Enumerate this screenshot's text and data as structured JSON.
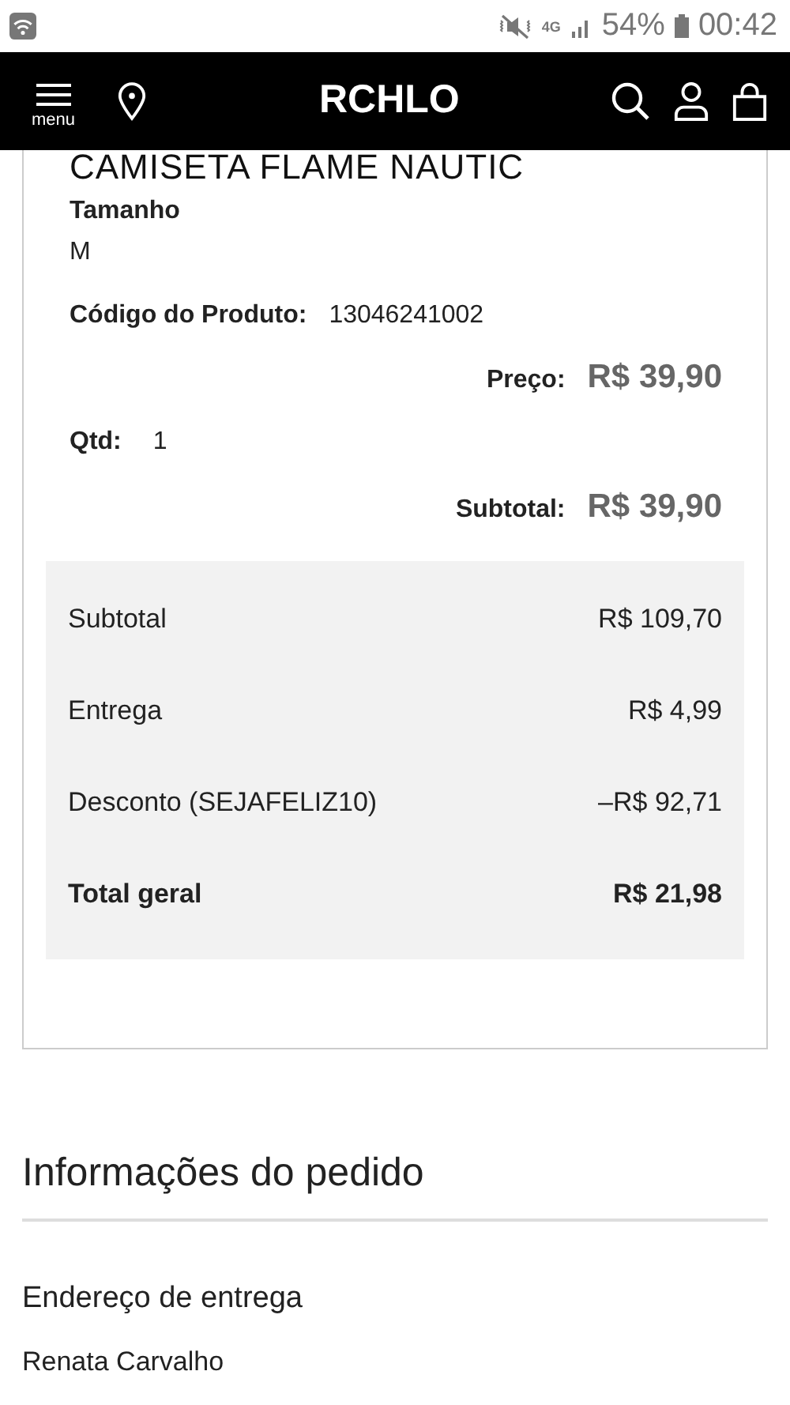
{
  "status_bar": {
    "network": "4G",
    "battery": "54%",
    "time": "00:42"
  },
  "header": {
    "menu_label": "menu",
    "logo": "RCHLO"
  },
  "product": {
    "title": "CAMISETA FLAME NAUTIC",
    "size_label": "Tamanho",
    "size": "M",
    "code_label": "Código do Produto:",
    "code": "13046241002",
    "price_label": "Preço:",
    "price": "R$ 39,90",
    "qty_label": "Qtd:",
    "qty": "1",
    "subtotal_label": "Subtotal:",
    "subtotal": "R$ 39,90"
  },
  "summary": [
    {
      "label": "Subtotal",
      "value": "R$ 109,70",
      "kind": "line"
    },
    {
      "label": "Entrega",
      "value": "R$ 4,99",
      "kind": "line"
    },
    {
      "label": "Desconto (SEJAFELIZ10)",
      "value": "–R$ 92,71",
      "kind": "line"
    },
    {
      "label": "Total geral",
      "value": "R$ 21,98",
      "kind": "total"
    }
  ],
  "order_info": {
    "title": "Informações do pedido",
    "address_title": "Endereço de entrega",
    "name": "Renata Carvalho"
  }
}
